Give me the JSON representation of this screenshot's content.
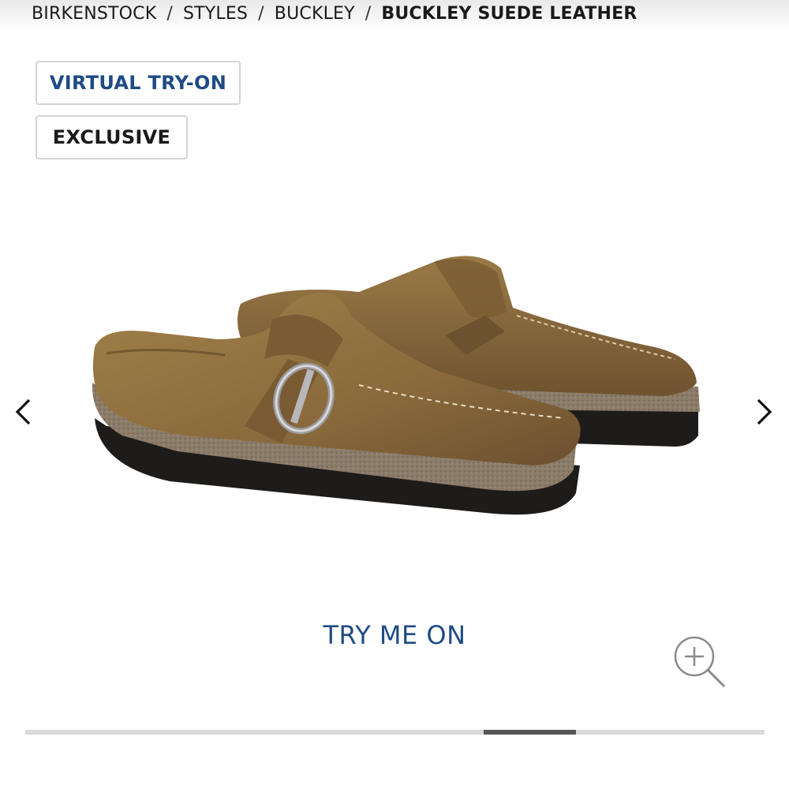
{
  "breadcrumb": {
    "items": [
      "BIRKENSTOCK",
      "STYLES",
      "BUCKLEY"
    ],
    "current": "BUCKLEY SUEDE LEATHER",
    "separator": "/"
  },
  "badges": {
    "virtual_try_on": "VIRTUAL TRY-ON",
    "exclusive": "EXCLUSIVE"
  },
  "product": {
    "image_icon": "suede-clog-pair",
    "suede_color": "#8a6a3c",
    "cork_color": "#8b7b69",
    "sole_color": "#1e1c1a"
  },
  "carousel": {
    "prev_icon": "chevron-left-icon",
    "next_icon": "chevron-right-icon",
    "progress_start": 0.62,
    "progress_end": 0.745
  },
  "cta": {
    "try_me_on": "TRY ME ON"
  },
  "zoom": {
    "icon": "zoom-in-icon"
  },
  "colors": {
    "brand_blue": "#1f4b86",
    "badge_border": "#d4d4d4",
    "track": "#d9d9d9",
    "thumb": "#555555"
  }
}
